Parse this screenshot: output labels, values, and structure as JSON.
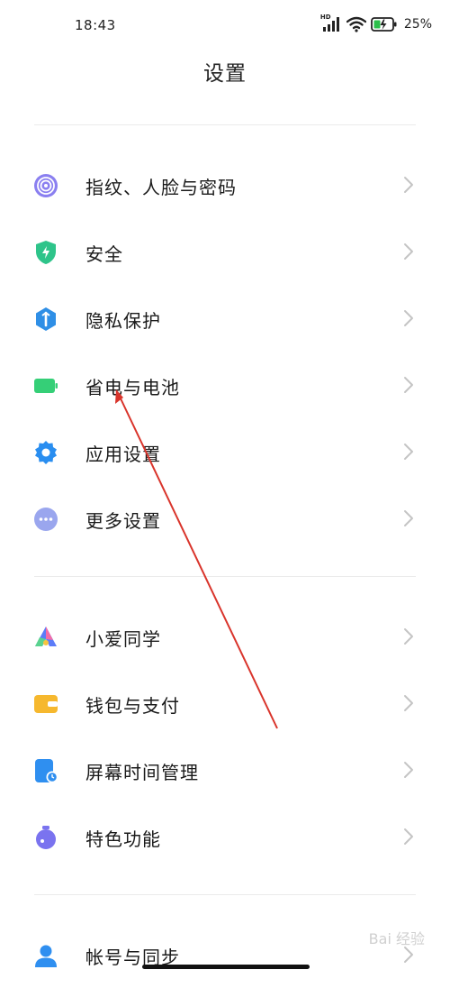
{
  "status_bar": {
    "time": "18:43",
    "network_badge": "HD",
    "signal_icon": "signal-bars-icon",
    "wifi_icon": "wifi-icon",
    "battery_icon": "battery-charging-icon",
    "battery_percent": "25%"
  },
  "page_title": "设置",
  "groups": [
    {
      "items": [
        {
          "label": "指纹、人脸与密码",
          "icon": "fingerprint-icon",
          "icon_color": "#8a7ff0"
        },
        {
          "label": "安全",
          "icon": "shield-icon",
          "icon_color": "#2ec48a"
        },
        {
          "label": "隐私保护",
          "icon": "privacy-icon",
          "icon_color": "#2f8fe6"
        },
        {
          "label": "省电与电池",
          "icon": "battery-icon",
          "icon_color": "#35cf77"
        },
        {
          "label": "应用设置",
          "icon": "gear-icon",
          "icon_color": "#2a8ef0"
        },
        {
          "label": "更多设置",
          "icon": "more-icon",
          "icon_color": "#9aa6ee"
        }
      ]
    },
    {
      "items": [
        {
          "label": "小爱同学",
          "icon": "xiaoai-icon",
          "icon_color": "#5c7cf8"
        },
        {
          "label": "钱包与支付",
          "icon": "wallet-icon",
          "icon_color": "#f6b82e"
        },
        {
          "label": "屏幕时间管理",
          "icon": "screen-time-icon",
          "icon_color": "#2f8ff0"
        },
        {
          "label": "特色功能",
          "icon": "features-icon",
          "icon_color": "#7a73ef"
        }
      ]
    },
    {
      "items": [
        {
          "label": "帐号与同步",
          "icon": "account-icon",
          "icon_color": "#2f8ff0"
        }
      ]
    }
  ],
  "annotation_color": "#d9342b",
  "watermark_text": "Bai 经验"
}
